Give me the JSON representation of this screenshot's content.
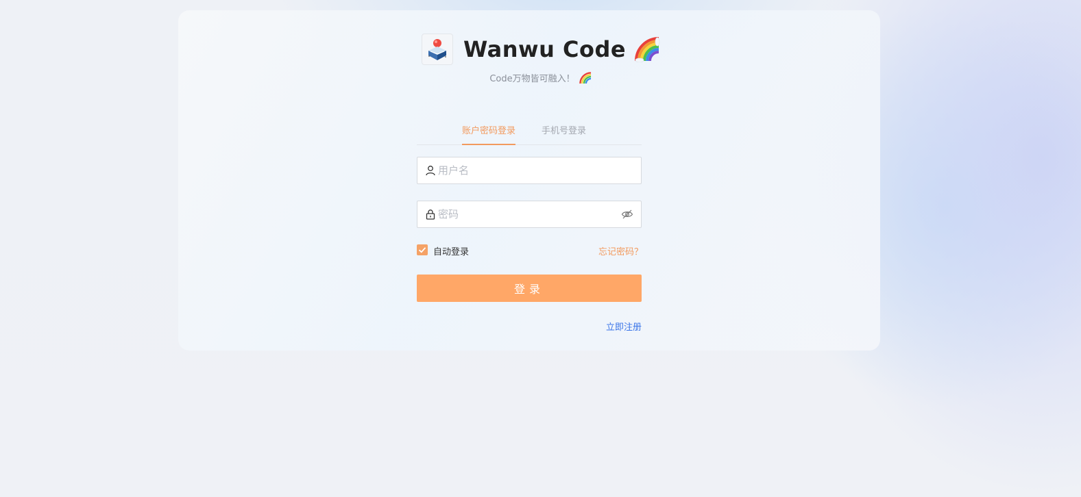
{
  "brand": {
    "title": "Wanwu Code",
    "subtitle": "Code万物皆可融入！",
    "logo_icon": "brand-logo-icon",
    "title_emoji_icon": "rainbow-icon"
  },
  "tabs": [
    {
      "label": "账户密码登录",
      "active": true
    },
    {
      "label": "手机号登录",
      "active": false
    }
  ],
  "form": {
    "username_placeholder": "用户名",
    "username_value": "",
    "password_placeholder": "密码",
    "password_value": "",
    "remember_label": "自动登录",
    "remember_checked": true,
    "forgot_label": "忘记密码？",
    "login_label": "登录",
    "register_label": "立即注册"
  },
  "colors": {
    "accent": "#ffa767",
    "accent_text": "#f29a5e",
    "link": "#3a74e8"
  }
}
